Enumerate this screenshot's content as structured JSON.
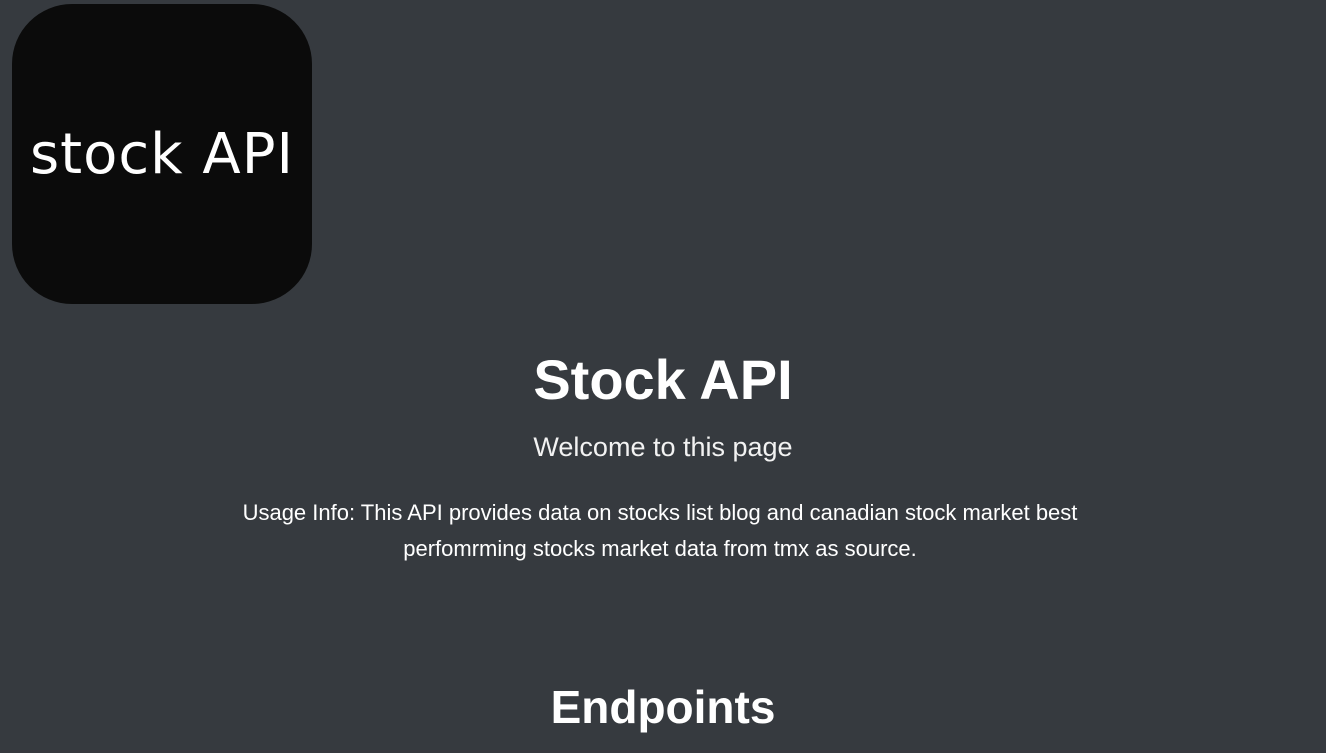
{
  "logo": {
    "text": "stock API",
    "background": "#0b0b0b"
  },
  "header": {
    "title": "Stock API",
    "subtitle": "Welcome to this page"
  },
  "usage": {
    "text": "Usage Info: This API provides data on stocks list blog and canadian stock market best perfomrming stocks market data from tmx as source."
  },
  "sections": {
    "endpoints_title": "Endpoints"
  },
  "colors": {
    "background": "#363a3f",
    "text": "#ffffff"
  }
}
